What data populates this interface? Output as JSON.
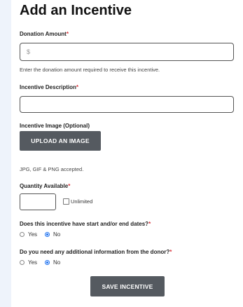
{
  "form": {
    "title": "Add an Incentive",
    "donation_label": "Donation Amount",
    "donation_placeholder": "$",
    "donation_help": "Enter the donation amount required to receive this incentive.",
    "description_label": "Incentive Description",
    "description_value": "",
    "image_label": "Incentive Image (Optional)",
    "upload_button": "UPLOAD AN IMAGE",
    "image_help": "JPG, GIF & PNG accepted.",
    "quantity_label": "Quantity Available",
    "quantity_value": "",
    "unlimited_label": "Unlimited",
    "dates_question": "Does this incentive have start and/or end dates?",
    "info_question": "Do you need any additional information from the donor?",
    "yes_label": "Yes",
    "no_label": "No",
    "required_marker": "*",
    "save_button": "SAVE INCENTIVE"
  },
  "colors": {
    "accent": "#1a6ff0",
    "required": "#d9363e",
    "button_bg": "#555a60"
  }
}
